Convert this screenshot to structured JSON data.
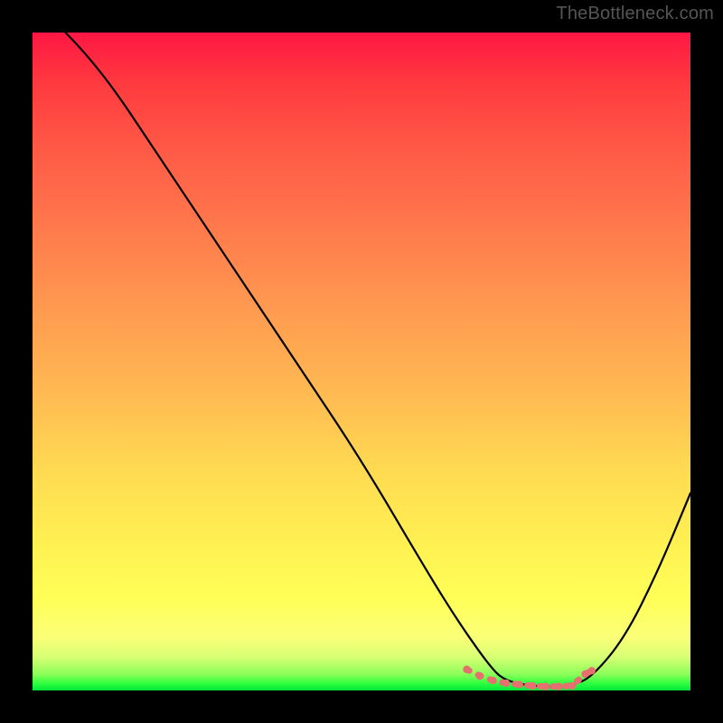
{
  "watermark": "TheBottleneck.com",
  "chart_data": {
    "type": "line",
    "title": "",
    "xlabel": "",
    "ylabel": "",
    "xlim": [
      0,
      100
    ],
    "ylim": [
      0,
      100
    ],
    "series": [
      {
        "name": "main-curve",
        "stroke": "#000000",
        "x": [
          5,
          10,
          20,
          30,
          40,
          50,
          60,
          65,
          70,
          72,
          75,
          78,
          80,
          82,
          85,
          90,
          95,
          100
        ],
        "y": [
          100,
          95,
          80,
          65,
          50,
          35,
          18,
          10,
          3,
          1.5,
          0.8,
          0.6,
          0.6,
          0.8,
          2,
          8,
          18,
          30
        ]
      },
      {
        "name": "highlight-dots",
        "stroke": "#e6706f",
        "marker": "circle",
        "x": [
          66,
          68,
          70,
          72,
          74,
          76,
          78,
          80,
          82,
          84,
          85
        ],
        "y": [
          3.2,
          2.2,
          1.5,
          1.1,
          0.9,
          0.7,
          0.6,
          0.6,
          0.7,
          2.5,
          3.0
        ]
      }
    ],
    "gradient_stops": [
      {
        "pos": 0.0,
        "color": "#ff1744"
      },
      {
        "pos": 0.5,
        "color": "#ffb050"
      },
      {
        "pos": 0.85,
        "color": "#ffff57"
      },
      {
        "pos": 1.0,
        "color": "#00e63a"
      }
    ]
  }
}
